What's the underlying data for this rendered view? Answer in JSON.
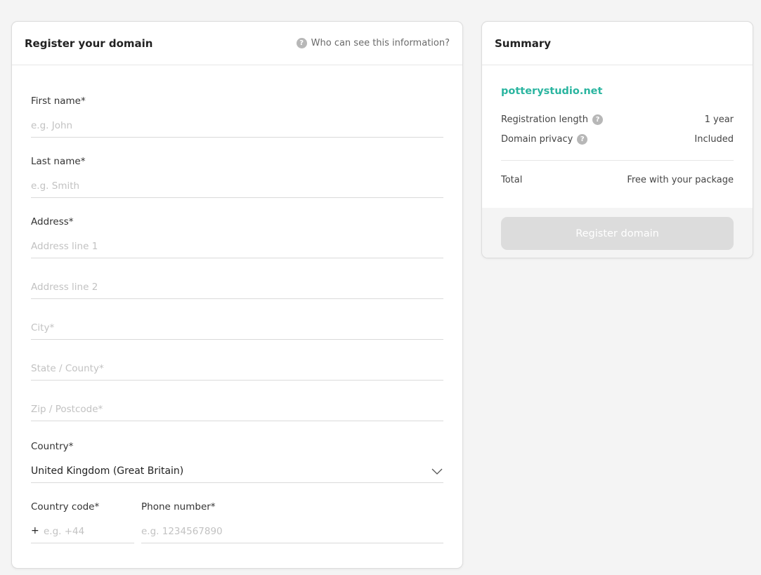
{
  "form": {
    "title": "Register your domain",
    "help_link": "Who can see this information?",
    "first_name": {
      "label": "First name*",
      "placeholder": "e.g. John"
    },
    "last_name": {
      "label": "Last name*",
      "placeholder": "e.g. Smith"
    },
    "address": {
      "label": "Address*",
      "line1_placeholder": "Address line 1",
      "line2_placeholder": "Address line 2",
      "city_placeholder": "City*",
      "state_placeholder": "State / County*",
      "zip_placeholder": "Zip / Postcode*"
    },
    "country": {
      "label": "Country*",
      "value": "United Kingdom (Great Britain)"
    },
    "country_code": {
      "label": "Country code*",
      "prefix": "+",
      "placeholder": "e.g. +44"
    },
    "phone": {
      "label": "Phone number*",
      "placeholder": "e.g. 1234567890"
    }
  },
  "summary": {
    "title": "Summary",
    "domain": "potterystudio.net",
    "rows": [
      {
        "label": "Registration length",
        "value": "1 year"
      },
      {
        "label": "Domain privacy",
        "value": "Included"
      }
    ],
    "total_label": "Total",
    "total_value": "Free with your package",
    "button_label": "Register domain"
  },
  "icons": {
    "help": "question-circle-icon",
    "dropdown": "chevron-down-icon"
  },
  "colors": {
    "accent": "#2bb5a0",
    "background": "#f4f4f4",
    "button_disabled": "#dcdcdc"
  }
}
